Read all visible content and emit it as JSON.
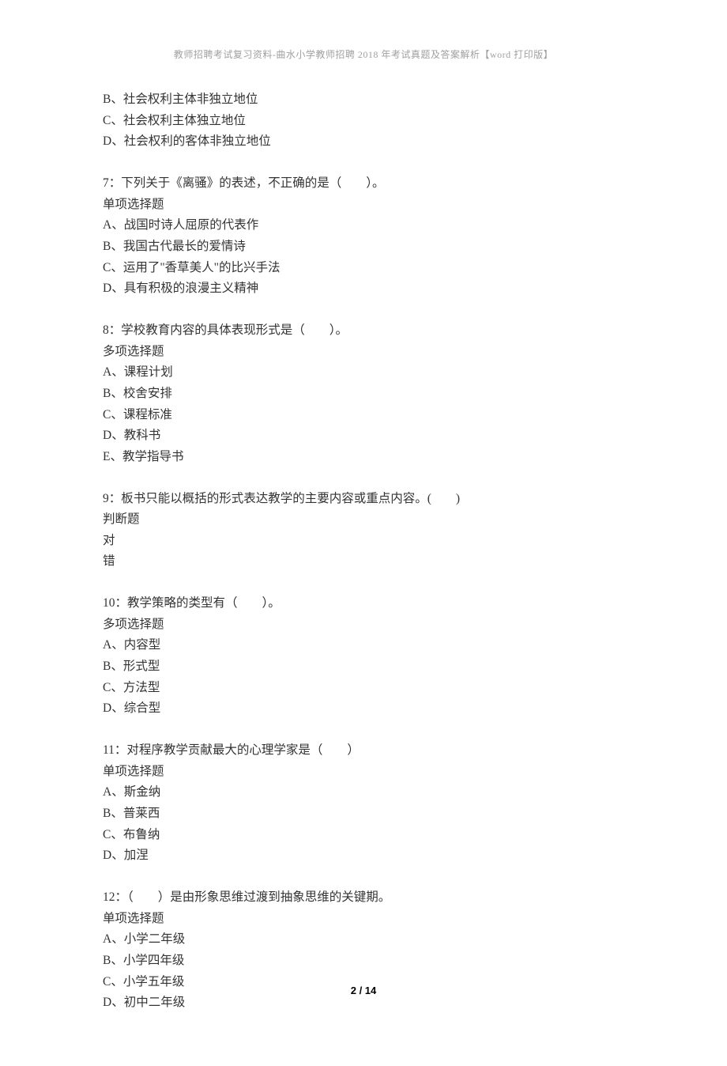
{
  "header": "教师招聘考试复习资料-曲水小学教师招聘 2018 年考试真题及答案解析【word 打印版】",
  "q6_options": [
    "B、社会权利主体非独立地位",
    "C、社会权利主体独立地位",
    "D、社会权利的客体非独立地位"
  ],
  "q7": {
    "stem": "7：下列关于《离骚》的表述，不正确的是（　　）。",
    "type": "单项选择题",
    "options": [
      "A、战国时诗人屈原的代表作",
      "B、我国古代最长的爱情诗",
      "C、运用了\"香草美人\"的比兴手法",
      "D、具有积极的浪漫主义精神"
    ]
  },
  "q8": {
    "stem": "8：学校教育内容的具体表现形式是（　　）。",
    "type": "多项选择题",
    "options": [
      "A、课程计划",
      "B、校舍安排",
      "C、课程标准",
      "D、教科书",
      "E、教学指导书"
    ]
  },
  "q9": {
    "stem": "9：板书只能以概括的形式表达教学的主要内容或重点内容。(　　)",
    "type": "判断题",
    "options": [
      "对",
      "错"
    ]
  },
  "q10": {
    "stem": "10：教学策略的类型有（　　）。",
    "type": "多项选择题",
    "options": [
      "A、内容型",
      "B、形式型",
      "C、方法型",
      "D、综合型"
    ]
  },
  "q11": {
    "stem": "11：对程序教学贡献最大的心理学家是（　　）",
    "type": "单项选择题",
    "options": [
      "A、斯金纳",
      "B、普莱西",
      "C、布鲁纳",
      "D、加涅"
    ]
  },
  "q12": {
    "stem": "12：（　　）是由形象思维过渡到抽象思维的关键期。",
    "type": "单项选择题",
    "options": [
      "A、小学二年级",
      "B、小学四年级",
      "C、小学五年级",
      "D、初中二年级"
    ]
  },
  "footer": {
    "page": "2",
    "sep": " / ",
    "total": "14"
  }
}
